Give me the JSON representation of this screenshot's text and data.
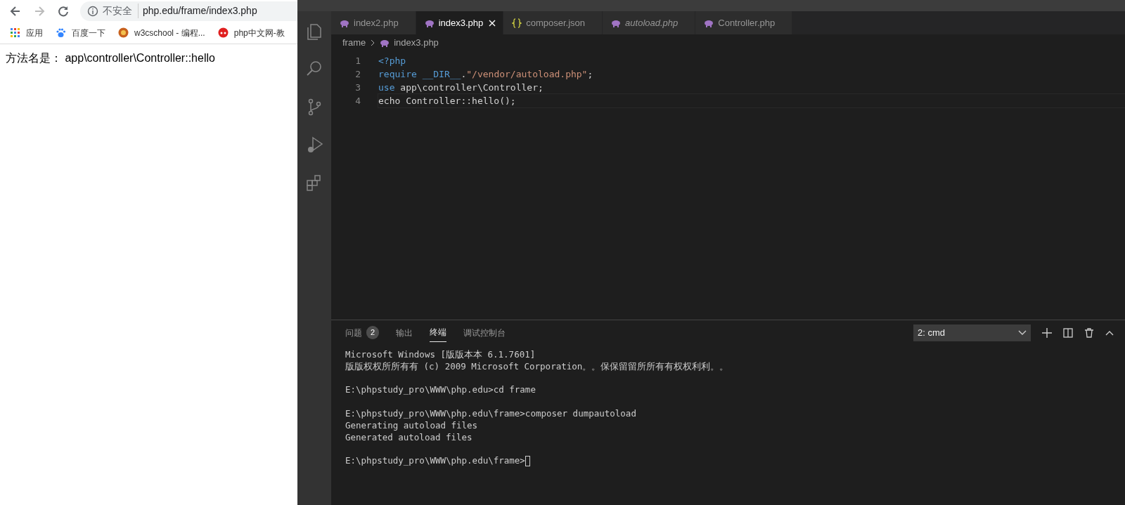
{
  "browser": {
    "nav_buttons": [
      {
        "kind": "back",
        "disabled": false
      },
      {
        "kind": "forward",
        "disabled": true
      },
      {
        "kind": "reload",
        "disabled": false
      }
    ],
    "address_bar": {
      "security": "不安全",
      "url": "php.edu/frame/index3.php"
    },
    "bookmarks": [
      {
        "kind": "apps",
        "label": "应用"
      },
      {
        "kind": "paw",
        "label": "百度一下"
      },
      {
        "kind": "flower",
        "label": "w3cschool - 编程..."
      },
      {
        "kind": "php",
        "label": "php中文网-教"
      }
    ],
    "page_text": "方法名是： app\\controller\\Controller::hello"
  },
  "editor": {
    "activity_bar": [
      {
        "kind": "explorer"
      },
      {
        "kind": "search"
      },
      {
        "kind": "source-control"
      },
      {
        "kind": "debug"
      },
      {
        "kind": "extensions"
      }
    ],
    "tabs": [
      {
        "label": "index2.php",
        "kind": "php",
        "selected": false,
        "italic": false
      },
      {
        "label": "index3.php",
        "kind": "php",
        "selected": true,
        "italic": false
      },
      {
        "label": "composer.json",
        "kind": "json",
        "selected": false,
        "italic": false
      },
      {
        "label": "autoload.php",
        "kind": "php",
        "selected": false,
        "italic": true
      },
      {
        "label": "Controller.php",
        "kind": "php",
        "selected": false,
        "italic": false
      }
    ],
    "breadcrumb": [
      "frame",
      "index3.php"
    ],
    "lines": [
      {
        "number": "1",
        "tokens": [
          {
            "kind": "tag",
            "text": "<?php"
          }
        ]
      },
      {
        "number": "2",
        "tokens": [
          {
            "kind": "keyword",
            "text": "require "
          },
          {
            "kind": "constant",
            "text": "__DIR__"
          },
          {
            "kind": "plain",
            "text": "."
          },
          {
            "kind": "string",
            "text": "\"/vendor/autoload.php\""
          },
          {
            "kind": "plain",
            "text": ";"
          }
        ]
      },
      {
        "number": "3",
        "tokens": [
          {
            "kind": "keyword",
            "text": "use "
          },
          {
            "kind": "plain",
            "text": "app\\controller\\Controller;"
          }
        ]
      },
      {
        "number": "4",
        "tokens": [
          {
            "kind": "plain",
            "text": "echo Controller::hello();"
          }
        ]
      }
    ]
  },
  "panel": {
    "tabs": [
      {
        "label": "问题",
        "badge": "2",
        "selected": false
      },
      {
        "label": "输出",
        "selected": false
      },
      {
        "label": "终端",
        "selected": true
      },
      {
        "label": "调试控制台",
        "selected": false
      }
    ],
    "terminal_select": "2: cmd",
    "terminal_blocks": [
      [
        "Microsoft Windows [版版本本 6.1.7601]",
        "版版权权所所有有 (c) 2009 Microsoft Corporation。。保保留留所所有有权权利利。。"
      ],
      [
        "E:\\phpstudy_pro\\WWW\\php.edu>cd frame"
      ],
      [
        "E:\\phpstudy_pro\\WWW\\php.edu\\frame>composer dumpautoload",
        "Generating autoload files",
        "Generated autoload files"
      ],
      [
        "E:\\phpstudy_pro\\WWW\\php.edu\\frame>"
      ]
    ]
  }
}
